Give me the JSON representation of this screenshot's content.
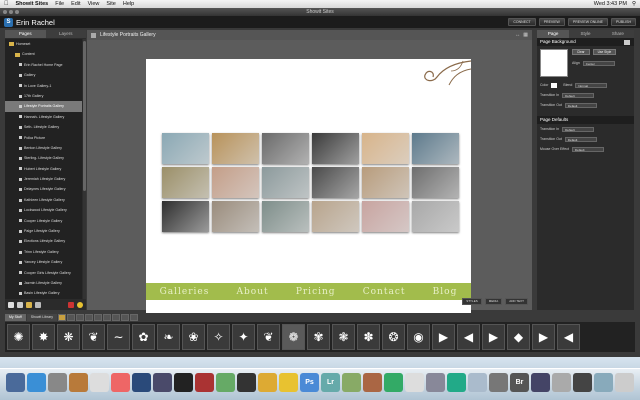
{
  "menubar": {
    "apple": "",
    "app": "Showit Sites",
    "items": [
      "File",
      "Edit",
      "View",
      "Site",
      "Help"
    ],
    "clock": "Wed 3:43 PM"
  },
  "window": {
    "title": "Showit Sites"
  },
  "header": {
    "site_name": "Erin Rachel",
    "buttons": [
      "CONNECT",
      "PREVIEW",
      "PREVIEW ONLINE",
      "PUBLISH"
    ]
  },
  "left": {
    "tabs": [
      "Pages",
      "Layers"
    ],
    "tree": [
      {
        "label": "Homeset",
        "type": "root"
      },
      {
        "label": "Content",
        "type": "folder"
      },
      {
        "label": "Erin Rachel Home Page",
        "type": "page"
      },
      {
        "label": "Gallery",
        "type": "page"
      },
      {
        "label": "In Love Gallery-1",
        "type": "page"
      },
      {
        "label": "17th Gallery",
        "type": "page"
      },
      {
        "label": "Lifestyle Portraits Gallery",
        "type": "page",
        "selected": true
      },
      {
        "label": "Hannah- Lifestyle Gallery",
        "type": "page"
      },
      {
        "label": "Seth- Lifestyle Gallery",
        "type": "page"
      },
      {
        "label": "Polka Picture",
        "type": "page"
      },
      {
        "label": "Benton Lifestyle Gallery",
        "type": "page"
      },
      {
        "label": "Sterling- Lifestyle Gallery",
        "type": "page"
      },
      {
        "label": "Hubert Lifestyle Gallery",
        "type": "page"
      },
      {
        "label": "Jeremiah Lifestyle Gallery",
        "type": "page"
      },
      {
        "label": "Delaynes Lifestyle Gallery",
        "type": "page"
      },
      {
        "label": "Kathleen Lifestyle Gallery",
        "type": "page"
      },
      {
        "label": "Lockwood Lifestyle Gallery",
        "type": "page"
      },
      {
        "label": "Cooper Lifestyle Gallery",
        "type": "page"
      },
      {
        "label": "Paige Lifestyle Gallery",
        "type": "page"
      },
      {
        "label": "Elections Lifestyle Gallery",
        "type": "page"
      },
      {
        "label": "Trinn Lifestyle Gallery",
        "type": "page"
      },
      {
        "label": "Yancey Lifestyle Gallery",
        "type": "page"
      },
      {
        "label": "Cooper Girls Lifestyle Gallery",
        "type": "page"
      },
      {
        "label": "Jazmin Lifestyle Gallery",
        "type": "page"
      },
      {
        "label": "Basin Lifestyle Gallery",
        "type": "page"
      }
    ]
  },
  "center": {
    "title": "Lifestyle Portraits Gallery",
    "nav": [
      "Galleries",
      "About",
      "Pricing",
      "Contact",
      "Blog"
    ],
    "photo_colors": [
      "#8aa8b4",
      "#b8925a",
      "#6a6a6a",
      "#3a3a3a",
      "#d8b48a",
      "#5d7a8c",
      "#9b8f68",
      "#c49e88",
      "#8c9a9c",
      "#4a4a4a",
      "#b89c7c",
      "#6e6e6e",
      "#2e2e2e",
      "#9a8c7c",
      "#7e8e8a",
      "#b8a48c",
      "#c8a4a0",
      "#a8a8a8"
    ],
    "buttons": [
      "STYLES",
      "MEDIA",
      "ADD TEXT"
    ]
  },
  "right": {
    "tabs": [
      "Page",
      "Style",
      "Share"
    ],
    "page_background": {
      "label": "Page Background",
      "clear": "Clear",
      "use_style": "Use Style",
      "align_label": "Align",
      "align": "Center",
      "color_label": "Color",
      "blend_label": "Blend",
      "blend": "Normal",
      "trans_in_label": "Transition In",
      "trans_in": "Default",
      "trans_out_label": "Transition Out",
      "trans_out": "Default"
    },
    "page_defaults": {
      "label": "Page Defaults",
      "trans_in_label": "Transition In",
      "trans_in": "Default",
      "trans_out_label": "Transition Out",
      "trans_out": "Default",
      "mouse_label": "Mouse Over Effect",
      "mouse": "Default"
    }
  },
  "bottom": {
    "tabs": [
      "My Stuff",
      "Showit Library"
    ]
  },
  "strip": {
    "glyphs": [
      "✺",
      "✸",
      "❋",
      "❦",
      "∼",
      "✿",
      "❧",
      "❀",
      "✧",
      "✦",
      "❦",
      "❁",
      "✾",
      "❃",
      "✽",
      "❂",
      "◉",
      "▶",
      "◀",
      "▶",
      "◆",
      "▶",
      "◀"
    ]
  },
  "dock": {
    "colors": [
      "#4a6a9a",
      "#3a8fd6",
      "#888",
      "#b87a3a",
      "#ddd",
      "#e66",
      "#2a4a7a",
      "#4a4a6a",
      "#222",
      "#a33",
      "#6a6",
      "#333",
      "#da3",
      "#e8c230",
      "#4a8ad6",
      "#6aa",
      "#8a6",
      "#a64",
      "#3a6",
      "#ddd",
      "#889",
      "#2a8",
      "#abc",
      "#777",
      "#555",
      "#446",
      "#aaa",
      "#444",
      "#8ab",
      "#ccc"
    ],
    "labels": {
      "14": "Ps",
      "15": "Lr",
      "24": "Br"
    }
  }
}
